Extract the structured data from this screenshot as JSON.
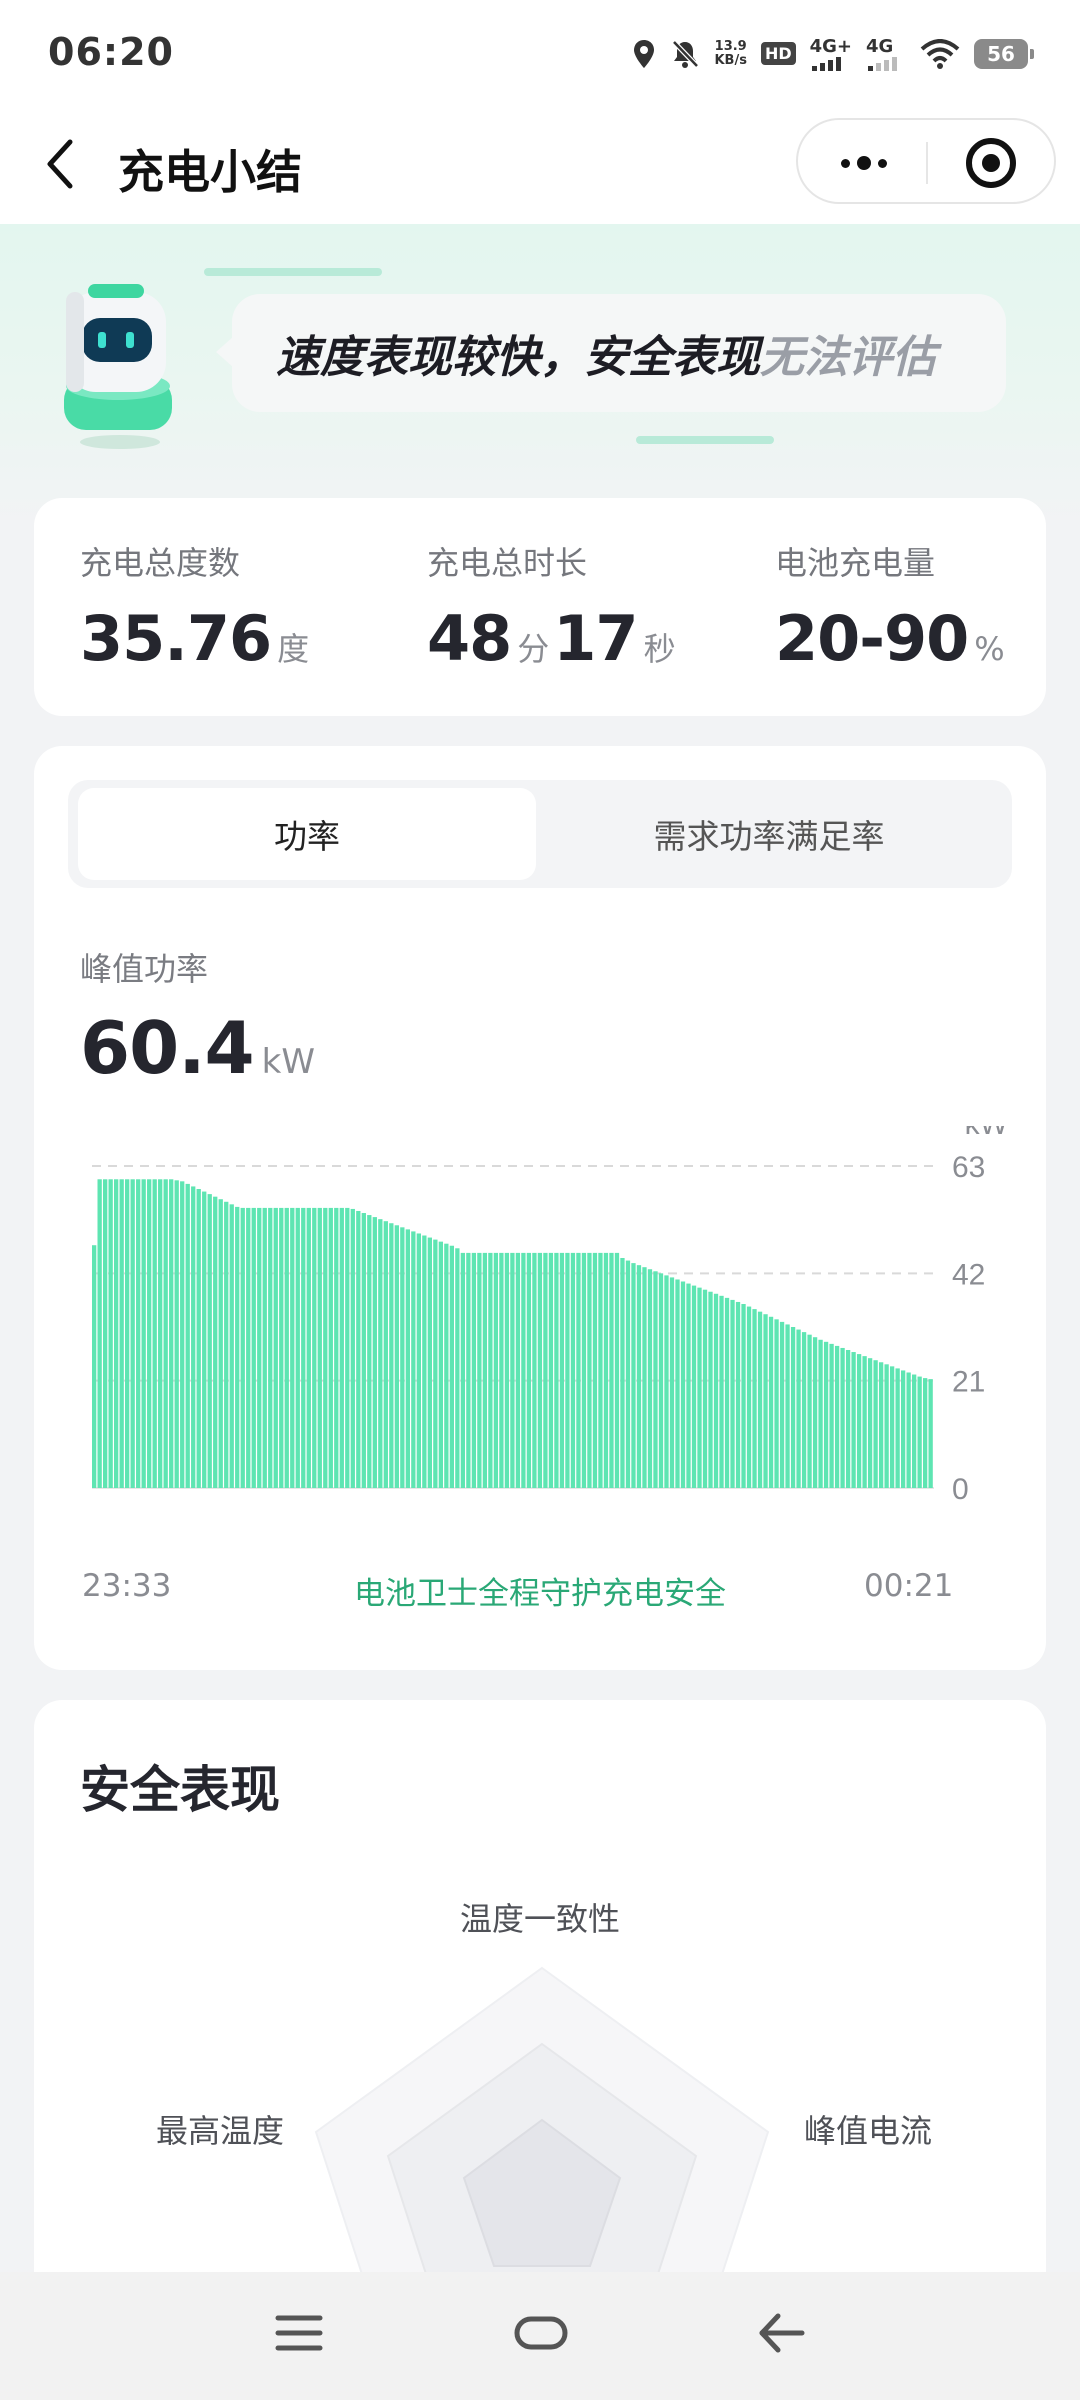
{
  "status_bar": {
    "time": "06:20",
    "net_speed_top": "13.9",
    "net_speed_bottom": "KB/s",
    "hd_label": "HD",
    "sig1_label": "4G+",
    "sig2_label": "4G",
    "battery": "56"
  },
  "nav": {
    "title": "充电小结"
  },
  "banner": {
    "text_main": "速度表现较快，安全表现",
    "text_gray": "无法评估"
  },
  "summary": {
    "items": [
      {
        "label": "充电总度数",
        "value": "35.76",
        "unit": "度"
      },
      {
        "label": "充电总时长",
        "value1": "48",
        "unit1": "分",
        "value2": "17",
        "unit2": "秒"
      },
      {
        "label": "电池充电量",
        "value": "20-90",
        "unit": "%"
      }
    ]
  },
  "power_panel": {
    "tabs": [
      "功率",
      "需求功率满足率"
    ],
    "active_tab": "功率",
    "peak_label": "峰值功率",
    "peak_value": "60.4",
    "peak_unit": "kW",
    "footer_center": "电池卫士全程守护充电安全"
  },
  "chart_data": {
    "type": "bar",
    "unit_label": "kW",
    "yticks": [
      "63",
      "42",
      "21",
      "0"
    ],
    "ylim": [
      0,
      63
    ],
    "x_start": "23:33",
    "x_end": "00:21",
    "grid_dashed_at": [
      63,
      42,
      21
    ],
    "values": [
      47.5,
      60.4,
      60.4,
      60.4,
      60.4,
      60.4,
      60.4,
      60.4,
      60.4,
      60.4,
      60.4,
      60.4,
      60.4,
      60.4,
      60.4,
      60.2,
      60.0,
      59.5,
      59.0,
      58.5,
      58.0,
      57.5,
      57.0,
      56.5,
      56.0,
      55.5,
      55.0,
      54.8,
      54.8,
      54.8,
      54.8,
      54.8,
      54.8,
      54.8,
      54.8,
      54.8,
      54.8,
      54.8,
      54.8,
      54.8,
      54.8,
      54.8,
      54.8,
      54.8,
      54.8,
      54.8,
      54.8,
      54.6,
      54.2,
      53.8,
      53.4,
      53.0,
      52.6,
      52.2,
      51.8,
      51.4,
      51.0,
      50.6,
      50.2,
      49.8,
      49.4,
      49.0,
      48.6,
      48.2,
      47.8,
      47.4,
      46.9,
      46.0,
      46.0,
      46.0,
      46.0,
      46.0,
      46.0,
      46.0,
      46.0,
      46.0,
      46.0,
      46.0,
      46.0,
      46.0,
      46.0,
      46.0,
      46.0,
      46.0,
      46.0,
      46.0,
      46.0,
      46.0,
      46.0,
      46.0,
      46.0,
      46.0,
      46.0,
      46.0,
      46.0,
      46.0,
      45.0,
      44.5,
      44.0,
      43.6,
      43.2,
      42.8,
      42.4,
      42.0,
      41.6,
      41.2,
      40.8,
      40.4,
      40.0,
      39.6,
      39.2,
      38.8,
      38.4,
      38.0,
      37.6,
      37.2,
      36.8,
      36.4,
      36.0,
      35.5,
      35.0,
      34.5,
      34.0,
      33.5,
      33.0,
      32.5,
      32.0,
      31.5,
      31.0,
      30.5,
      30.0,
      29.5,
      29.0,
      28.6,
      28.2,
      27.8,
      27.4,
      27.0,
      26.6,
      26.2,
      25.8,
      25.4,
      25.0,
      24.6,
      24.2,
      23.8,
      23.4,
      23.0,
      22.6,
      22.2,
      21.8,
      21.5,
      21.3
    ]
  },
  "safety": {
    "title": "安全表现",
    "radar_labels": {
      "top": "温度一致性",
      "left": "最高温度",
      "right": "峰值电流"
    }
  },
  "colors": {
    "accent_green": "#2fd39a",
    "bar_green": "#5ee5b2",
    "text_green": "#2aa876"
  }
}
